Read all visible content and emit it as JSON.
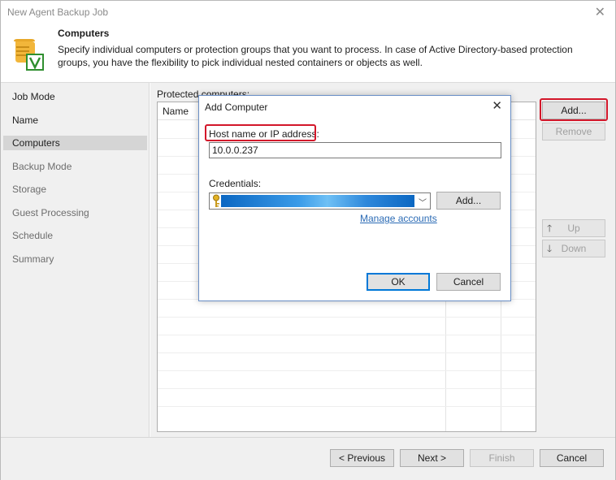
{
  "window": {
    "title": "New Agent Backup Job",
    "close_glyph": "✕"
  },
  "header": {
    "title": "Computers",
    "description": "Specify individual computers or protection groups that you want to process. In case of Active Directory-based protection groups, you have the flexibility to pick individual nested containers or objects as well.",
    "icon": "scroll-checkmark-icon"
  },
  "sidebar": {
    "items": [
      {
        "label": "Job Mode",
        "state": "normal"
      },
      {
        "label": "Name",
        "state": "normal"
      },
      {
        "label": "Computers",
        "state": "active"
      },
      {
        "label": "Backup Mode",
        "state": "disabled"
      },
      {
        "label": "Storage",
        "state": "disabled"
      },
      {
        "label": "Guest Processing",
        "state": "disabled"
      },
      {
        "label": "Schedule",
        "state": "disabled"
      },
      {
        "label": "Summary",
        "state": "disabled"
      }
    ]
  },
  "main": {
    "protected_label": "Protected computers:",
    "columns": [
      "Name"
    ],
    "buttons": {
      "add": "Add...",
      "remove": "Remove",
      "up": "Up",
      "down": "Down"
    }
  },
  "footer": {
    "previous": "< Previous",
    "next": "Next >",
    "finish": "Finish",
    "cancel": "Cancel"
  },
  "dialog": {
    "title": "Add Computer",
    "close_glyph": "✕",
    "host_label": "Host name or IP address:",
    "host_value": "10.0.0.237",
    "credentials_label": "Credentials:",
    "credentials_add": "Add...",
    "manage_accounts": "Manage accounts",
    "ok": "OK",
    "cancel": "Cancel"
  },
  "colors": {
    "highlight": "#d3172a",
    "accent": "#0078d7",
    "link": "#2b6bb5"
  },
  "icons": {
    "up": "arrow-up-icon",
    "down": "arrow-down-icon",
    "key": "key-icon"
  }
}
